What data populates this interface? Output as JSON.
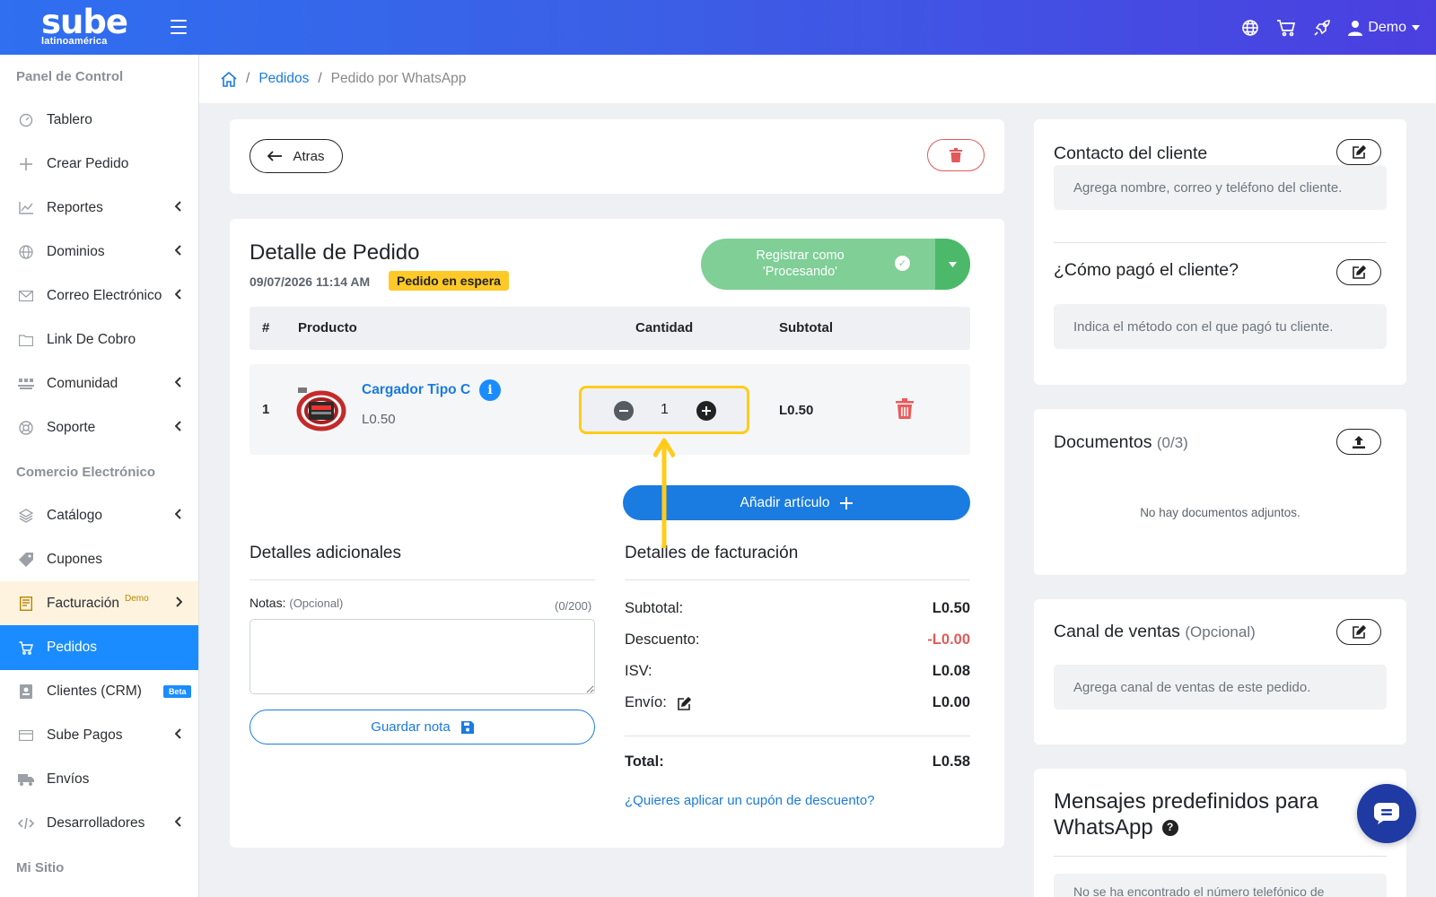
{
  "header": {
    "logo_main": "sube",
    "logo_sub": "latinoamérica",
    "user_label": "Demo"
  },
  "sidebar": {
    "section_panel": "Panel de Control",
    "section_ecommerce": "Comercio Electrónico",
    "section_site": "Mi Sitio",
    "items": [
      {
        "label": "Tablero",
        "icon": "gauge-icon"
      },
      {
        "label": "Crear Pedido",
        "icon": "plus-icon"
      },
      {
        "label": "Reportes",
        "icon": "chart-line-icon"
      },
      {
        "label": "Dominios",
        "icon": "globe-icon"
      },
      {
        "label": "Correo Electrónico",
        "icon": "envelope-icon"
      },
      {
        "label": "Link De Cobro",
        "icon": "folder-icon"
      },
      {
        "label": "Comunidad",
        "icon": "users-icon"
      },
      {
        "label": "Soporte",
        "icon": "lifebuoy-icon"
      },
      {
        "label": "Catálogo",
        "icon": "layers-icon"
      },
      {
        "label": "Cupones",
        "icon": "tag-icon"
      },
      {
        "label": "Facturación",
        "icon": "receipt-icon",
        "badge": "Demo"
      },
      {
        "label": "Pedidos",
        "icon": "cart-icon"
      },
      {
        "label": "Clientes (CRM)",
        "icon": "contact-card-icon",
        "badge": "Beta"
      },
      {
        "label": "Sube Pagos",
        "icon": "credit-card-icon"
      },
      {
        "label": "Envíos",
        "icon": "truck-icon"
      },
      {
        "label": "Desarrolladores",
        "icon": "code-icon"
      }
    ]
  },
  "breadcrumb": {
    "orders": "Pedidos",
    "current": "Pedido por WhatsApp"
  },
  "actions": {
    "back_label": "Atras"
  },
  "order": {
    "title": "Detalle de Pedido",
    "date": "09/07/2026 11:14 AM",
    "status": "Pedido en espera",
    "register_button": "Registrar como 'Procesando'",
    "table_headers": {
      "num": "#",
      "product": "Producto",
      "quantity": "Cantidad",
      "subtotal": "Subtotal"
    },
    "items": [
      {
        "num": "1",
        "name": "Cargador Tipo C",
        "price": "L0.50",
        "quantity": "1",
        "subtotal": "L0.50"
      }
    ],
    "add_item_label": "Añadir artículo"
  },
  "additional": {
    "title": "Detalles adicionales",
    "notes_label": "Notas:",
    "notes_optional": "(Opcional)",
    "notes_count": "(0/200)",
    "notes_value": "",
    "save_note_label": "Guardar nota"
  },
  "billing": {
    "title": "Detalles de facturación",
    "subtotal_label": "Subtotal:",
    "subtotal_value": "L0.50",
    "discount_label": "Descuento:",
    "discount_value": "-L0.00",
    "tax_label": "ISV:",
    "tax_value": "L0.08",
    "shipping_label": "Envío:",
    "shipping_value": "L0.00",
    "total_label": "Total:",
    "total_value": "L0.58",
    "coupon_link": "¿Quieres aplicar un cupón de descuento?"
  },
  "right": {
    "contact_title": "Contacto del cliente",
    "contact_placeholder": "Agrega nombre, correo y teléfono del cliente.",
    "payment_title": "¿Cómo pagó el cliente?",
    "payment_placeholder": "Indica el método con el que pagó tu cliente.",
    "documents_title": "Documentos",
    "documents_count": "(0/3)",
    "documents_empty": "No hay documentos adjuntos.",
    "channel_title": "Canal de ventas",
    "channel_optional": "(Opcional)",
    "channel_placeholder": "Agrega canal de ventas de este pedido.",
    "whatsapp_title_1": "Mensajes predefinidos para",
    "whatsapp_title_2": "WhatsApp",
    "whatsapp_text": "No se ha encontrado el número telefónico de"
  },
  "colors": {
    "primary": "#1a7be0",
    "active_sidebar": "#1a8cff",
    "status_badge": "#ffc928",
    "register_green": "#7fcf96",
    "danger": "#e05a5a",
    "highlight_yellow": "#ffcc1a"
  }
}
